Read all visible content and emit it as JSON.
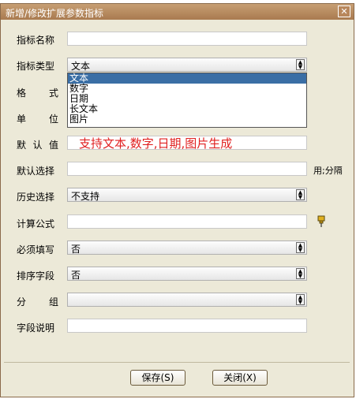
{
  "window": {
    "title": "新增/修改扩展参数指标",
    "close": "✕"
  },
  "fields": {
    "name": {
      "label": "指标名称",
      "value": ""
    },
    "type": {
      "label": "指标类型",
      "value": "文本"
    },
    "format": {
      "label_a": "格",
      "label_b": "式",
      "value": ""
    },
    "unit": {
      "label_a": "单",
      "label_b": "位",
      "value": ""
    },
    "default_value": {
      "label_a": "默",
      "label_b": "认",
      "label_c": "值",
      "value": ""
    },
    "default_choice": {
      "label": "默认选择",
      "value": "",
      "side_text": "用;分隔"
    },
    "history": {
      "label": "历史选择",
      "value": "不支持"
    },
    "formula": {
      "label": "计算公式",
      "value": ""
    },
    "required": {
      "label": "必须填写",
      "value": "否"
    },
    "sort_field": {
      "label": "排序字段",
      "value": "否"
    },
    "group": {
      "label_a": "分",
      "label_b": "组",
      "value": ""
    },
    "description": {
      "label": "字段说明",
      "value": ""
    }
  },
  "type_options": [
    "文本",
    "数字",
    "日期",
    "长文本",
    "图片"
  ],
  "annotation": "支持文本,数字,日期,图片生成",
  "buttons": {
    "save": "保存(S)",
    "close": "关闭(X)"
  },
  "colors": {
    "titlebar": "#b98c60",
    "selection": "#3a6ea5",
    "annotation": "#e02020",
    "dialog_bg": "#ece9d8"
  },
  "icons": {
    "formula_pin": "pin-icon",
    "close": "close-icon",
    "dropdown": "chevron-down-icon"
  }
}
